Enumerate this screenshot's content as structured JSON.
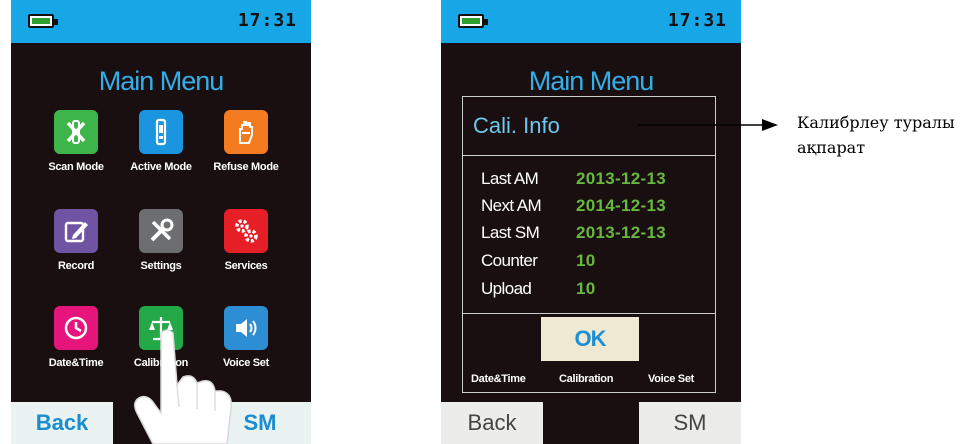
{
  "status": {
    "time": "17:31"
  },
  "screen1": {
    "title": "Main Menu",
    "items": [
      {
        "label": "Scan Mode",
        "icon": "scan-mode-icon",
        "color": "#3db54a"
      },
      {
        "label": "Active Mode",
        "icon": "active-mode-icon",
        "color": "#1b95df"
      },
      {
        "label": "Refuse Mode",
        "icon": "refuse-mode-icon",
        "color": "#f47b20"
      },
      {
        "label": "Record",
        "icon": "record-icon",
        "color": "#6f54a3"
      },
      {
        "label": "Settings",
        "icon": "settings-icon",
        "color": "#6d6e70"
      },
      {
        "label": "Services",
        "icon": "services-icon",
        "color": "#e61e26"
      },
      {
        "label": "Date&Time",
        "icon": "clock-icon",
        "color": "#e5157c"
      },
      {
        "label": "Calibration",
        "icon": "calibration-icon",
        "color": "#25a848"
      },
      {
        "label": "Voice Set",
        "icon": "speaker-icon",
        "color": "#2d8ed3"
      }
    ],
    "back": "Back",
    "sm": "SM"
  },
  "screen2": {
    "title": "Main Menu",
    "dialog": {
      "title": "Cali. Info",
      "rows": [
        {
          "label": "Last AM",
          "value": "2013-12-13"
        },
        {
          "label": "Next AM",
          "value": "2014-12-13"
        },
        {
          "label": "Last SM",
          "value": "2013-12-13"
        },
        {
          "label": "Counter",
          "value": "10"
        },
        {
          "label": "Upload",
          "value": "10"
        }
      ],
      "ok": "OK"
    },
    "under_labels": [
      "Date&Time",
      "Calibration",
      "Voice Set"
    ],
    "back": "Back",
    "sm": "SM"
  },
  "annotation": "Калибрлеу туралы ақпарат"
}
